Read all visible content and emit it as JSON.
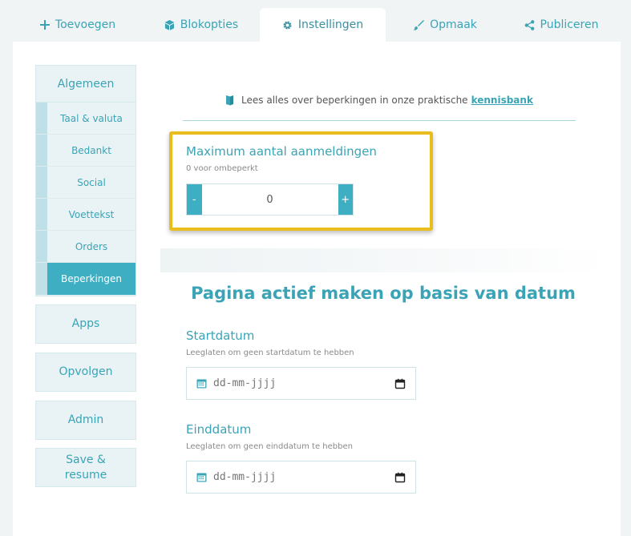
{
  "tabs": [
    {
      "label": "Toevoegen",
      "icon": "plus-icon"
    },
    {
      "label": "Blokopties",
      "icon": "cube-icon"
    },
    {
      "label": "Instellingen",
      "icon": "gear-icon"
    },
    {
      "label": "Opmaak",
      "icon": "brush-icon"
    },
    {
      "label": "Publiceren",
      "icon": "share-icon"
    }
  ],
  "sidebar": {
    "general": {
      "label": "Algemeen",
      "items": [
        "Taal & valuta",
        "Bedankt",
        "Social",
        "Voettekst",
        "Orders",
        "Beperkingen"
      ]
    },
    "buttons": [
      "Apps",
      "Opvolgen",
      "Admin",
      "Save & resume"
    ]
  },
  "info": {
    "text": "Lees alles over beperkingen in onze praktische",
    "link": "kennisbank"
  },
  "max_registrations": {
    "label": "Maximum aantal aanmeldingen",
    "hint": "0 voor ombeperkt",
    "minus": "-",
    "plus": "+",
    "value": "0"
  },
  "date_section": {
    "title": "Pagina actief maken op basis van datum",
    "start": {
      "label": "Startdatum",
      "hint": "Leeglaten om geen startdatum te hebben",
      "placeholder": "dd-mm-jjjj"
    },
    "end": {
      "label": "Einddatum",
      "hint": "Leeglaten om geen einddatum te hebben",
      "placeholder": "dd-mm-jjjj"
    }
  },
  "colors": {
    "accent": "#3eaec2",
    "highlight": "#e8bd1c"
  }
}
